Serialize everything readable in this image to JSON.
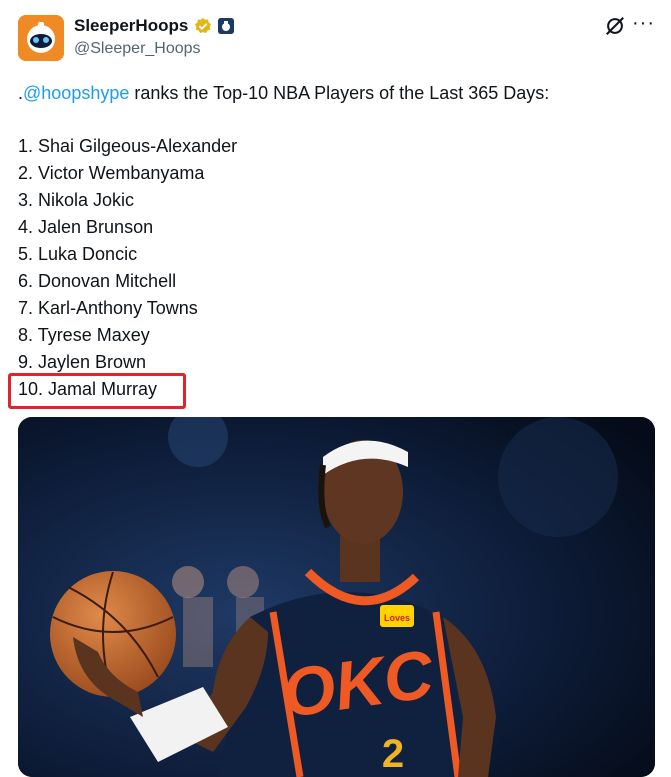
{
  "author": {
    "display_name": "SleeperHoops",
    "handle": "@Sleeper_Hoops"
  },
  "tweet": {
    "lead_dot": ".",
    "mention": "@hoopshype",
    "text_after_mention": " ranks the Top-10 NBA Players of the Last 365 Days:",
    "ranking": [
      "1. Shai Gilgeous-Alexander",
      "2. Victor Wembanyama",
      "3. Nikola Jokic",
      "4. Jalen Brunson",
      "5. Luka Doncic",
      "6. Donovan Mitchell",
      "7. Karl-Anthony Towns",
      "8. Tyrese Maxey",
      "9. Jaylen Brown",
      "10. Jamal Murray"
    ]
  },
  "media": {
    "jersey_text": "OKC",
    "jersey_number": "2",
    "patch_text": "Loves"
  },
  "icons": {
    "verified": "verified-badge-icon",
    "grok": "grok-icon",
    "more": "more-options-icon"
  },
  "colors": {
    "mention": "#1d9bf0",
    "highlight_box": "#e0242b",
    "verified_gold": "#e2b719",
    "okc_orange": "#ef5a24",
    "okc_navy": "#10213f"
  }
}
